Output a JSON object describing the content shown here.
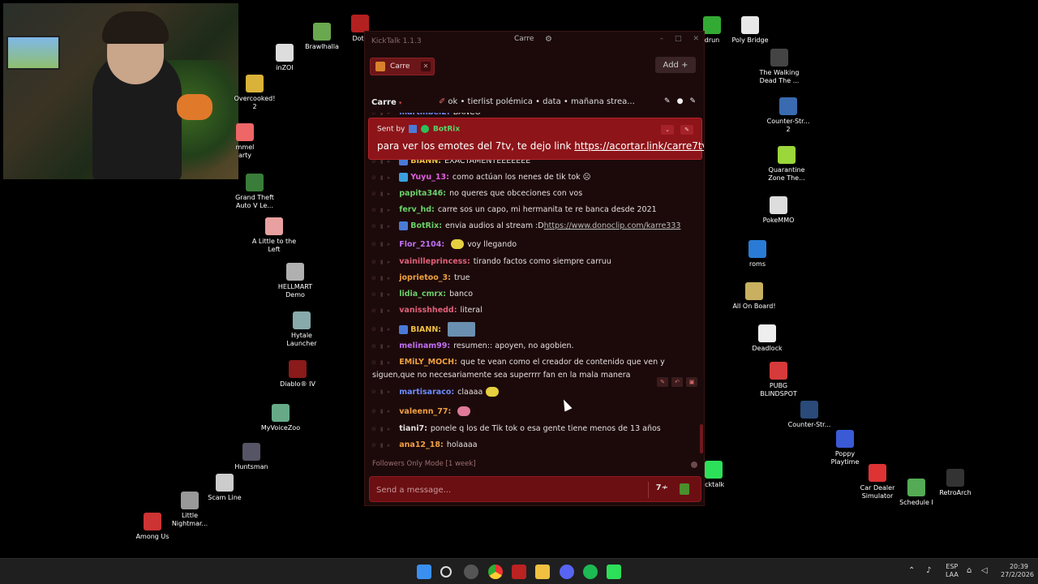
{
  "desktop": {
    "icons": [
      {
        "label": "Brawlhalla",
        "color": "#6aa84f"
      },
      {
        "label": "Dota",
        "color": "#b32020"
      },
      {
        "label": "inZOI",
        "color": "#ddd"
      },
      {
        "label": "Overcooked!\n2",
        "color": "#d9b23a"
      },
      {
        "label": "mmel\narty",
        "color": "#e66"
      },
      {
        "label": "Grand Theft\nAuto V Le...",
        "color": "#3a7d3a"
      },
      {
        "label": "A Little to the\nLeft",
        "color": "#e8a0a0"
      },
      {
        "label": "HELLMART\nDemo",
        "color": "#b0b0b0"
      },
      {
        "label": "Hytale\nLauncher",
        "color": "#8aa"
      },
      {
        "label": "Diablo® IV",
        "color": "#8b1a1a"
      },
      {
        "label": "MyVoiceZoo",
        "color": "#6a8"
      },
      {
        "label": "Huntsman",
        "color": "#556"
      },
      {
        "label": "Scam Line",
        "color": "#ccc"
      },
      {
        "label": "Little\nNightmar...",
        "color": "#999"
      },
      {
        "label": "Among Us",
        "color": "#c33"
      },
      {
        "label": "drun",
        "color": "#3a3"
      },
      {
        "label": "Poly Bridge",
        "color": "#e8e8e8"
      },
      {
        "label": "The Walking\nDead The ...",
        "color": "#444"
      },
      {
        "label": "Counter-Str...\n2",
        "color": "#3a6ab0"
      },
      {
        "label": "Quarantine\nZone The...",
        "color": "#9bd63a"
      },
      {
        "label": "PokeMMO",
        "color": "#ddd"
      },
      {
        "label": "roms",
        "color": "#2a7bd6"
      },
      {
        "label": "All On Board!",
        "color": "#c8b060"
      },
      {
        "label": "Deadlock",
        "color": "#eee"
      },
      {
        "label": "PUBG\nBLINDSPOT",
        "color": "#d63a3a"
      },
      {
        "label": "Counter-Str...",
        "color": "#2a4a7a"
      },
      {
        "label": "Poppy\nPlaytime",
        "color": "#3a5ad6"
      },
      {
        "label": "icktalk",
        "color": "#2de05a"
      },
      {
        "label": "Car Dealer\nSimulator",
        "color": "#d33"
      },
      {
        "label": "Schedule I",
        "color": "#5a5"
      },
      {
        "label": "RetroArch",
        "color": "#333"
      }
    ]
  },
  "app": {
    "title": "KickTalk 1.1.3",
    "title_tab": "Carre",
    "channel_tab": "Carre",
    "add_label": "Add  +",
    "channel_name": "Carre",
    "pins": "ok  • tierlist polémica  • data  • mañana strea...",
    "pinned": {
      "sent_by": "Sent by",
      "bot_name": "BotRix",
      "text": "para ver los emotes del 7tv, te dejo link ",
      "link": "https://acortar.link/carre7tv"
    },
    "messages": [
      {
        "user": "martinbei2:",
        "text": "BANCO",
        "ucolor": "#6a8cff"
      },
      {
        "user": "BIANN:",
        "text": "EXACTAMENTEEEEEEE",
        "ucolor": "#f0c040"
      },
      {
        "user": "Yuyu_13:",
        "text": "como actúan los nenes de tik tok ☹",
        "ucolor": "#e060e0"
      },
      {
        "user": "papita346:",
        "text": "no queres que obceciones con vos",
        "ucolor": "#6ad06a"
      },
      {
        "user": "ferv_hd:",
        "text": "carre sos un capo, mi hermanita te re banca desde 2021",
        "ucolor": "#6ad06a"
      },
      {
        "user": "BotRix:",
        "text": "envia audios al stream :D ",
        "link": "https://www.donoclip.com/karre333",
        "ucolor": "#6ad06a"
      },
      {
        "user": "Flor_2104:",
        "text": "voy llegando",
        "ucolor": "#c070f0"
      },
      {
        "user": "vainilleprincess:",
        "text": "tirando factos como siempre carruu",
        "ucolor": "#e0607a"
      },
      {
        "user": "joprietoo_3:",
        "text": "true",
        "ucolor": "#f0a040"
      },
      {
        "user": "lidia_cmrx:",
        "text": "banco",
        "ucolor": "#6ad06a"
      },
      {
        "user": "vanisshhedd:",
        "text": "literal",
        "ucolor": "#e0607a"
      },
      {
        "user": "BIANN:",
        "text": "",
        "ucolor": "#f0c040"
      },
      {
        "user": "melinam99:",
        "text": "resumen:: apoyen, no agobien.",
        "ucolor": "#c070f0"
      },
      {
        "user": "EMiLY_MOCH:",
        "text": "que te vean como el creador de contenido que ven y",
        "text2": "siguen,que no necesariamente sea superrrr fan en la mala manera",
        "ucolor": "#f0a040"
      },
      {
        "user": "martisaraco:",
        "text": "claaaa",
        "ucolor": "#6a8cff"
      },
      {
        "user": "valeenn_77:",
        "text": "",
        "ucolor": "#f0a040"
      },
      {
        "user": "tiani7:",
        "text": "ponele q los de Tik tok o esa gente tiene menos de 13 años",
        "ucolor": "#e6dede"
      },
      {
        "user": "ana12_18:",
        "text": "holaaaa",
        "ucolor": "#f0a040"
      }
    ],
    "followers_mode": "Followers Only Mode [1 week]",
    "input_placeholder": "Send a message..."
  },
  "taskbar": {
    "lang_top": "ESP",
    "lang_bottom": "LAA",
    "time": "20:39",
    "date": "27/2/2026"
  }
}
